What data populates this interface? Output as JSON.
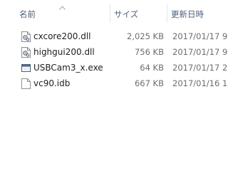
{
  "columns": {
    "name": "名前",
    "size": "サイズ",
    "date": "更新日時"
  },
  "files": [
    {
      "name": "cxcore200.dll",
      "size": "2,025 KB",
      "date": "2017/01/17 9",
      "icon": "dll-file-icon"
    },
    {
      "name": "highgui200.dll",
      "size": "756 KB",
      "date": "2017/01/17 9",
      "icon": "dll-file-icon"
    },
    {
      "name": "USBCam3_x.exe",
      "size": "64 KB",
      "date": "2017/01/17 2",
      "icon": "exe-app-icon"
    },
    {
      "name": "vc90.idb",
      "size": "667 KB",
      "date": "2017/01/16 1",
      "icon": "generic-file-icon"
    }
  ],
  "colors": {
    "header_text": "#4c607a",
    "detail_text": "#6d6d6d",
    "name_text": "#1e1e1e",
    "separator": "#e5e5e5"
  }
}
